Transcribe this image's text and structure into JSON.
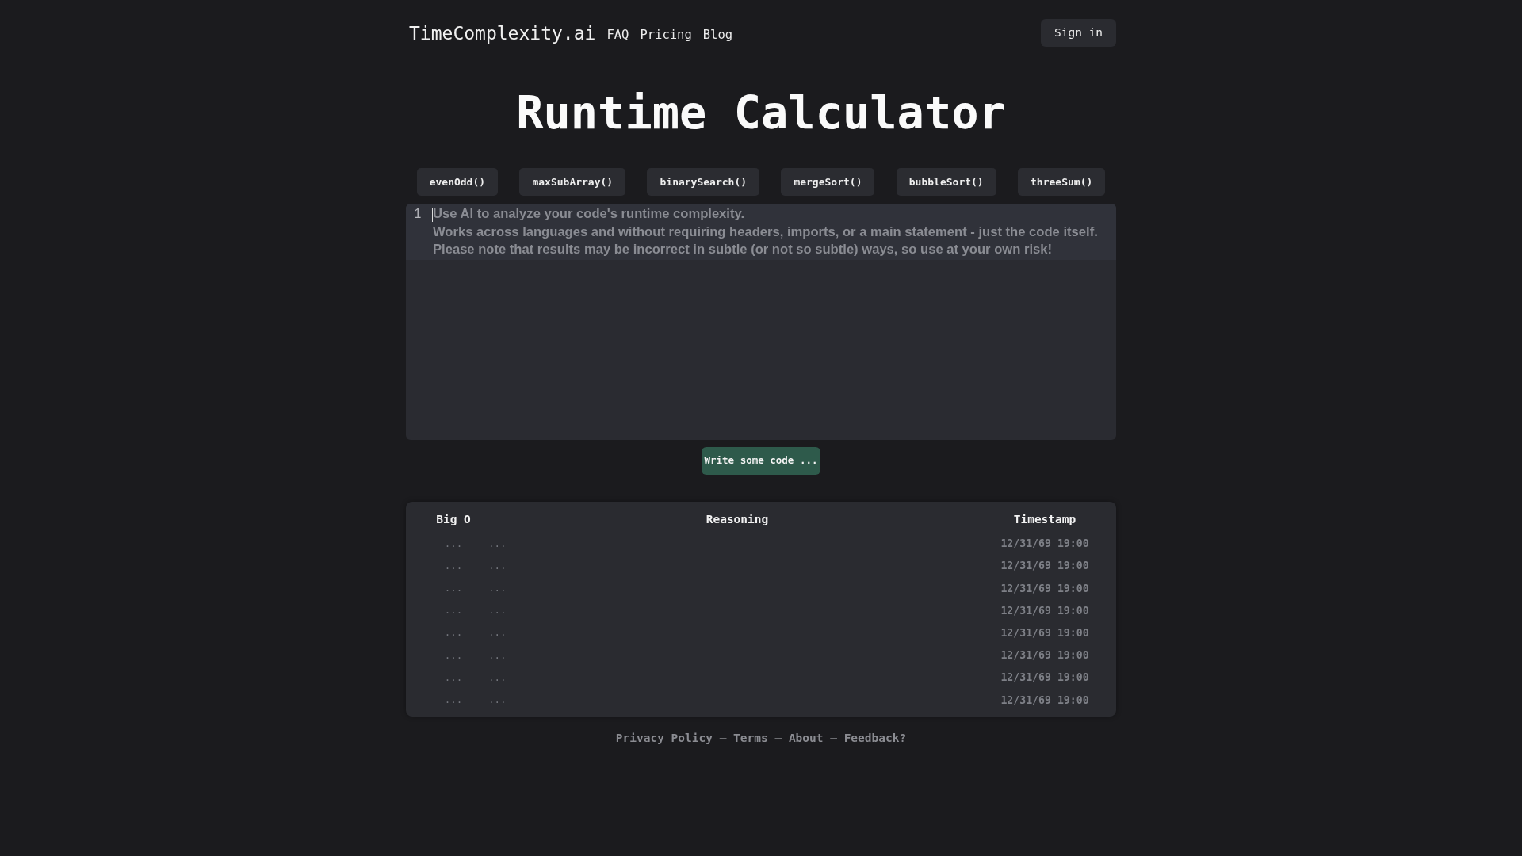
{
  "header": {
    "brand": "TimeComplexity.ai",
    "nav": [
      "FAQ",
      "Pricing",
      "Blog"
    ],
    "sign_in": "Sign in"
  },
  "title": "Runtime Calculator",
  "examples": [
    "evenOdd()",
    "maxSubArray()",
    "binarySearch()",
    "mergeSort()",
    "bubbleSort()",
    "threeSum()"
  ],
  "editor": {
    "line_numbers": [
      "1"
    ],
    "placeholder": "Use AI to analyze your code's runtime complexity.\nWorks across languages and without requiring headers, imports, or a main statement - just the code itself.\nPlease note that results may be incorrect in subtle (or not so subtle) ways, so use at your own risk!"
  },
  "submit_button": "Write some code ...",
  "table": {
    "columns": [
      "Big O",
      "Reasoning",
      "Timestamp"
    ],
    "rows": [
      {
        "big_o": "...",
        "reasoning": "...",
        "timestamp": "12/31/69 19:00"
      },
      {
        "big_o": "...",
        "reasoning": "...",
        "timestamp": "12/31/69 19:00"
      },
      {
        "big_o": "...",
        "reasoning": "...",
        "timestamp": "12/31/69 19:00"
      },
      {
        "big_o": "...",
        "reasoning": "...",
        "timestamp": "12/31/69 19:00"
      },
      {
        "big_o": "...",
        "reasoning": "...",
        "timestamp": "12/31/69 19:00"
      },
      {
        "big_o": "...",
        "reasoning": "...",
        "timestamp": "12/31/69 19:00"
      },
      {
        "big_o": "...",
        "reasoning": "...",
        "timestamp": "12/31/69 19:00"
      },
      {
        "big_o": "...",
        "reasoning": "...",
        "timestamp": "12/31/69 19:00"
      }
    ]
  },
  "footer": {
    "links": [
      {
        "text": "Privacy Policy"
      },
      {
        "separator": "–",
        "text": "Terms"
      },
      {
        "separator": "–",
        "text": "About"
      },
      {
        "separator": "–",
        "text": "Feedback?"
      }
    ]
  }
}
